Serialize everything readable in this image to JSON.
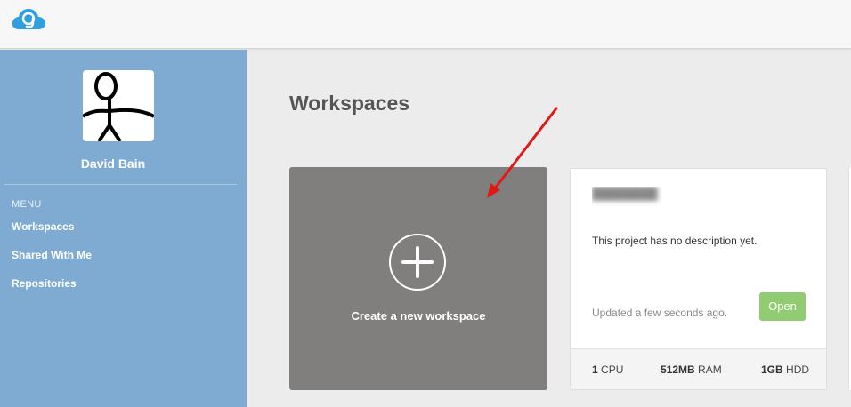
{
  "app": {
    "logo_icon": "cloud9-logo-icon"
  },
  "user": {
    "name": "David Bain"
  },
  "sidebar": {
    "menu_label": "MENU",
    "items": [
      {
        "label": "Workspaces"
      },
      {
        "label": "Shared With Me"
      },
      {
        "label": "Repositories"
      }
    ]
  },
  "main": {
    "title": "Workspaces",
    "create_card": {
      "label": "Create a new workspace",
      "icon": "plus-circle-icon"
    },
    "workspace_card": {
      "title": "████████",
      "description": "This project has no description yet.",
      "updated": "Updated a few seconds ago.",
      "open_label": "Open",
      "specs": {
        "cpu_value": "1",
        "cpu_unit": "CPU",
        "ram_value": "512MB",
        "ram_unit": "RAM",
        "hdd_value": "1GB",
        "hdd_unit": "HDD"
      }
    }
  },
  "colors": {
    "sidebar": "#7fabd3",
    "create_card": "#817f7d",
    "open_button": "#92cc72",
    "annotation_arrow": "#e01818"
  }
}
